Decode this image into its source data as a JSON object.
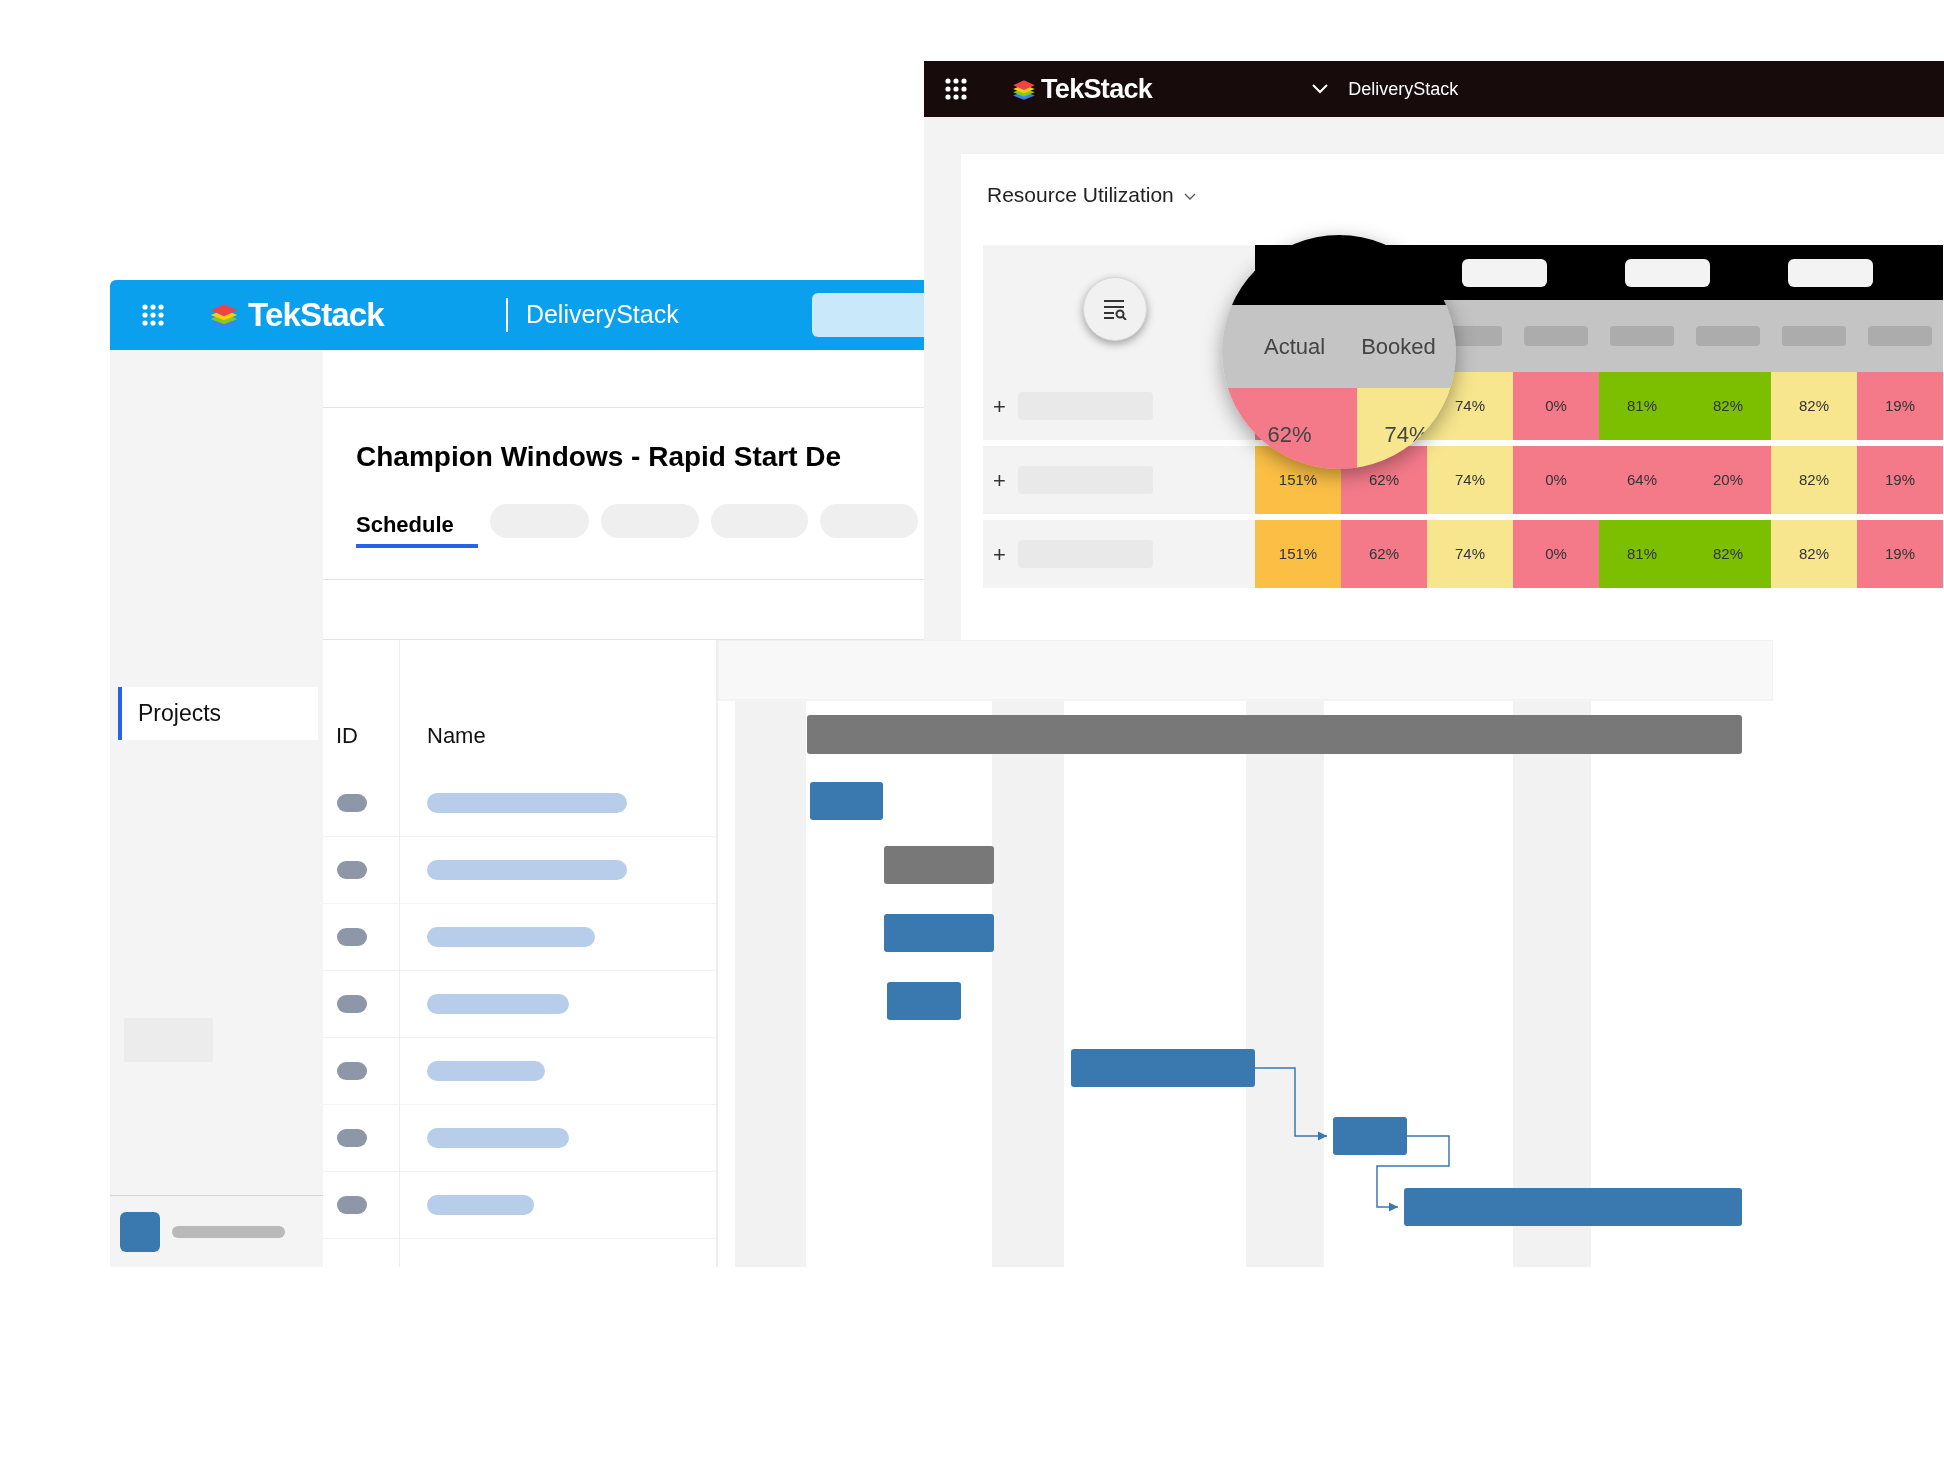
{
  "back_window": {
    "app_name": "TekStack",
    "module": "DeliveryStack",
    "sidebar": {
      "items": [
        {
          "label": "Projects",
          "selected": true
        }
      ]
    },
    "project_title": "Champion Windows - Rapid Start De",
    "tabs": [
      {
        "label": "Schedule",
        "selected": true
      }
    ],
    "table": {
      "columns": [
        "ID",
        "Name"
      ]
    }
  },
  "front_window": {
    "app_name": "TekStack",
    "module": "DeliveryStack",
    "report": {
      "title": "Resource Utilization"
    },
    "magnifier": {
      "columns": [
        "Actual",
        "Booked"
      ]
    },
    "rows": [
      {
        "expander": "+",
        "cells": [
          {
            "value": "62%",
            "color": "#f47a8a"
          },
          {
            "value": "74%",
            "color": "#f7e68e"
          },
          {
            "value": "74%",
            "color": "#f7e68e"
          },
          {
            "value": "0%",
            "color": "#f47a8a"
          },
          {
            "value": "81%",
            "color": "#7bbf00"
          },
          {
            "value": "82%",
            "color": "#7bbf00"
          },
          {
            "value": "82%",
            "color": "#f7e68e"
          },
          {
            "value": "19%",
            "color": "#f47a8a"
          }
        ]
      },
      {
        "expander": "+",
        "cells": [
          {
            "value": "151%",
            "color": "#fbbf45"
          },
          {
            "value": "62%",
            "color": "#f47a8a"
          },
          {
            "value": "74%",
            "color": "#f7e68e"
          },
          {
            "value": "0%",
            "color": "#f47a8a"
          },
          {
            "value": "64%",
            "color": "#f47a8a"
          },
          {
            "value": "20%",
            "color": "#f47a8a"
          },
          {
            "value": "82%",
            "color": "#f7e68e"
          },
          {
            "value": "19%",
            "color": "#f47a8a"
          }
        ]
      },
      {
        "expander": "+",
        "cells": [
          {
            "value": "151%",
            "color": "#fbbf45"
          },
          {
            "value": "62%",
            "color": "#f47a8a"
          },
          {
            "value": "74%",
            "color": "#f7e68e"
          },
          {
            "value": "0%",
            "color": "#f47a8a"
          },
          {
            "value": "81%",
            "color": "#7bbf00"
          },
          {
            "value": "82%",
            "color": "#7bbf00"
          },
          {
            "value": "82%",
            "color": "#f7e68e"
          },
          {
            "value": "19%",
            "color": "#f47a8a"
          }
        ]
      }
    ]
  }
}
